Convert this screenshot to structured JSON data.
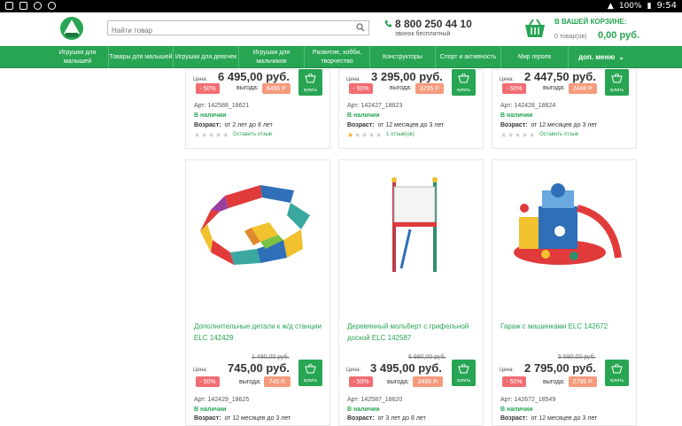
{
  "statusbar": {
    "battery": "100%",
    "time": "9:54"
  },
  "header": {
    "search_placeholder": "Найти товар",
    "phone": "8 800 250 44 10",
    "phone_sub": "звонок бесплатный",
    "cart_title": "В ВАШЕЙ КОРЗИНЕ:",
    "cart_count": "0 товар(ов)",
    "cart_sum": "0,00 руб."
  },
  "nav": {
    "items": [
      "Игрушки для малышей",
      "Товары для малышей",
      "Игрушки для девочек",
      "Игрушки для мальчиков",
      "Развитие, хобби, творчество",
      "Конструкторы",
      "Спорт и активность",
      "Мир героев",
      "доп. меню"
    ]
  },
  "common": {
    "price_label": "Цена:",
    "benefit_label": "выгода:",
    "buy_label": "купить",
    "in_stock": "В наличии",
    "age_label": "Возраст:",
    "leave_review": "Оставить отзыв"
  },
  "top_cards": [
    {
      "price": "6 495,00 руб.",
      "discount": "- 50%",
      "benefit": "6495 Р.",
      "art": "Арт: 142588_18621",
      "age": "от 2 лет до 8 лет",
      "rating": 0,
      "review": "Оставить отзыв"
    },
    {
      "price": "3 295,00 руб.",
      "discount": "- 50%",
      "benefit": "3295 Р.",
      "art": "Арт: 142427_18623",
      "age": "от 12 месяцев до 3 лет",
      "rating": 1,
      "review": "1 отзыв(ов)"
    },
    {
      "price": "2 447,50 руб.",
      "discount": "- 50%",
      "benefit": "2448 Р.",
      "art": "Арт: 142428_18624",
      "age": "от 12 месяцев до 3 лет",
      "rating": 0,
      "review": "Оставить отзыв"
    }
  ],
  "bottom_cards": [
    {
      "name": "Дополнительные детали к ж/д станции ELC 142429",
      "old_price": "1 490,00 руб.",
      "price": "745,00 руб.",
      "discount": "- 50%",
      "benefit": "745 Р.",
      "art": "Арт: 142429_18625",
      "age": "от 12 месяцев до 3 лет"
    },
    {
      "name": "Деревянный мольберт с грифельной доской ELC 142587",
      "old_price": "6 990,00 руб.",
      "price": "3 495,00 руб.",
      "discount": "- 50%",
      "benefit": "3495 Р.",
      "art": "Арт: 142587_18620",
      "age": "от 3 лет до 8 лет"
    },
    {
      "name": "Гараж с машинками ELC 142672",
      "old_price": "5 590,00 руб.",
      "price": "2 795,00 руб.",
      "discount": "- 50%",
      "benefit": "2795 Р.",
      "art": "Арт: 142672_18549",
      "age": "от 12 месяцев до 3 лет"
    }
  ],
  "colors": {
    "brand": "#27a553",
    "discount": "#f16d72",
    "benefit": "#f59a7c",
    "star": "#f2b01e"
  }
}
